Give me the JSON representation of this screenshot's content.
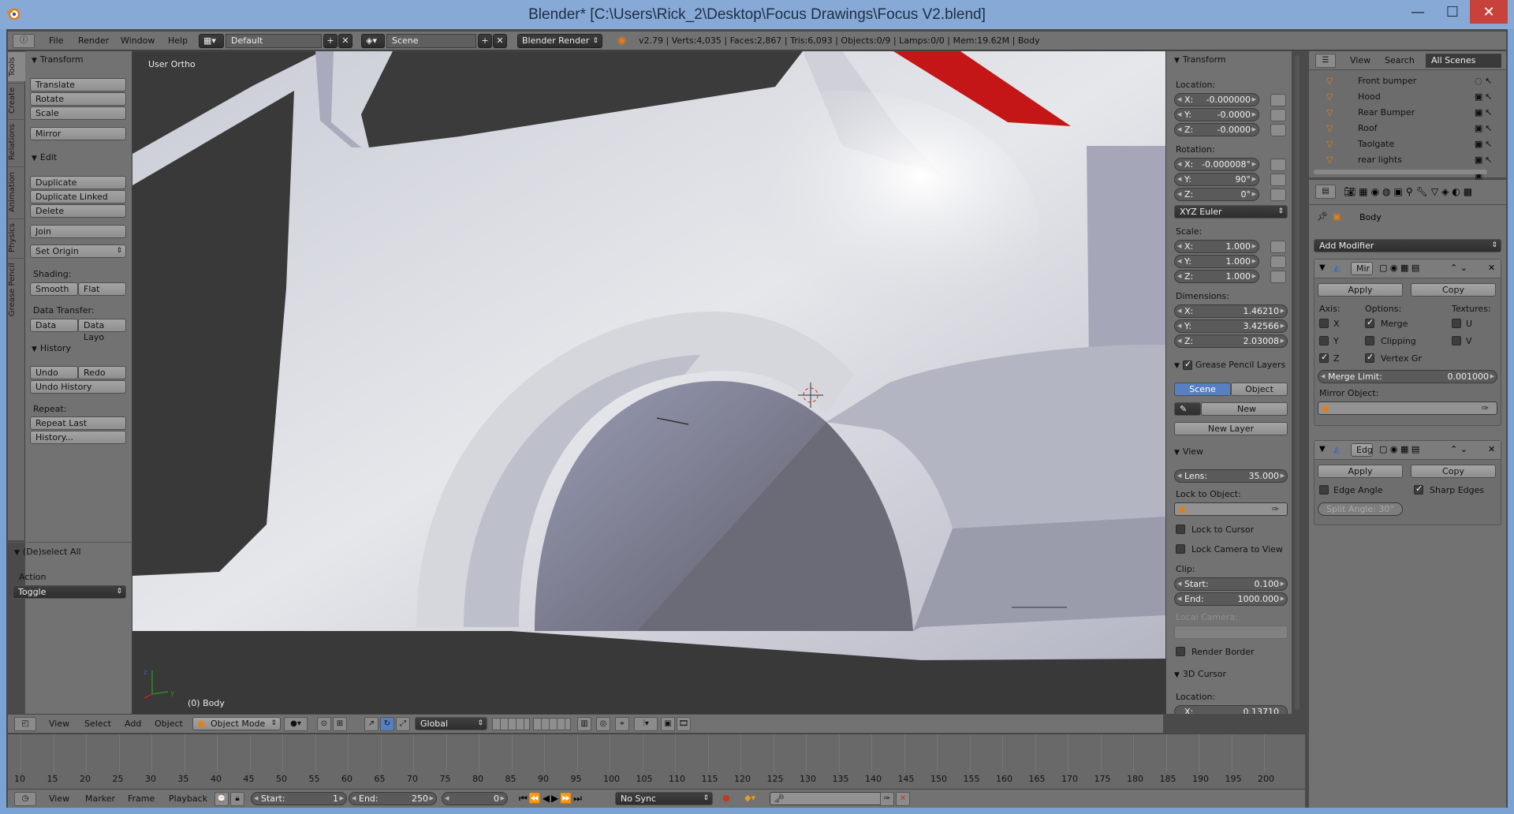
{
  "window": {
    "title": "Blender* [C:\\Users\\Rick_2\\Desktop\\Focus Drawings\\Focus V2.blend]",
    "minimize_glyph": "—",
    "maximize_glyph": "☐",
    "close_glyph": "✕"
  },
  "topbar": {
    "menus": [
      "File",
      "Render",
      "Window",
      "Help"
    ],
    "layout": "Default",
    "scene": "Scene",
    "engine": "Blender Render",
    "stats": "v2.79 | Verts:4,035 | Faces:2,867 | Tris:6,093 | Objects:0/9 | Lamps:0/0 | Mem:19.62M | Body"
  },
  "tabs": [
    "Tools",
    "Create",
    "Relations",
    "Animation",
    "Physics",
    "Grease Pencil"
  ],
  "toolshelf": {
    "transform": {
      "title": "Transform",
      "buttons": [
        "Translate",
        "Rotate",
        "Scale",
        "Mirror"
      ]
    },
    "edit": {
      "title": "Edit",
      "buttons": [
        "Duplicate",
        "Duplicate Linked",
        "Delete",
        "Join",
        "Set Origin"
      ]
    },
    "shading": {
      "label": "Shading:",
      "smooth": "Smooth",
      "flat": "Flat"
    },
    "data_transfer": {
      "label": "Data Transfer:",
      "data": "Data",
      "data_layo": "Data Layo"
    },
    "history": {
      "title": "History",
      "undo": "Undo",
      "redo": "Redo",
      "undo_history": "Undo History",
      "repeat_label": "Repeat:",
      "repeat_last": "Repeat Last",
      "history_more": "History..."
    },
    "operator": {
      "title": "(De)select All",
      "action_label": "Action",
      "action_value": "Toggle"
    }
  },
  "viewport": {
    "label": "User Ortho",
    "object_label": "(0) Body"
  },
  "npanel": {
    "transform_title": "Transform",
    "location_label": "Location:",
    "location": {
      "x": "-0.000000",
      "y": "-0.0000",
      "z": "-0.0000"
    },
    "rotation_label": "Rotation:",
    "rotation": {
      "x": "-0.000008°",
      "y": "90°",
      "z": "0°"
    },
    "rotation_mode": "XYZ Euler",
    "scale_label": "Scale:",
    "scale": {
      "x": "1.000",
      "y": "1.000",
      "z": "1.000"
    },
    "dimensions_label": "Dimensions:",
    "dimensions": {
      "x": "1.46210",
      "y": "3.42566",
      "z": "2.03008"
    },
    "grease_title": "Grease Pencil Layers",
    "grease_scene": "Scene",
    "grease_object": "Object",
    "grease_new": "New",
    "grease_new_layer": "New Layer",
    "view_title": "View",
    "lens_label": "Lens:",
    "lens_value": "35.000",
    "lock_to_object": "Lock to Object:",
    "lock_to_cursor": "Lock to Cursor",
    "lock_camera": "Lock Camera to View",
    "clip_label": "Clip:",
    "clip_start_label": "Start:",
    "clip_start": "0.100",
    "clip_end_label": "End:",
    "clip_end": "1000.000",
    "local_camera": "Local Camera:",
    "render_border": "Render Border",
    "cursor_title": "3D Cursor",
    "cursor_location": "Location:",
    "cursor_x_label": "X:",
    "cursor_x": "0.13710"
  },
  "outliner": {
    "menus": [
      "View",
      "Search"
    ],
    "filter": "All Scenes",
    "items": [
      "Front bumper",
      "Hood",
      "Rear Bumper",
      "Roof",
      "Taolgate",
      "rear lights"
    ]
  },
  "properties": {
    "object": "Body",
    "add_modifier": "Add Modifier",
    "mirror": {
      "name": "Mir",
      "apply": "Apply",
      "copy": "Copy",
      "axis_label": "Axis:",
      "options_label": "Options:",
      "textures_label": "Textures:",
      "x": "X",
      "y": "Y",
      "z": "Z",
      "merge": "Merge",
      "clipping": "Clipping",
      "vertex_gr": "Vertex Gr",
      "u": "U",
      "v": "V",
      "merge_limit_label": "Merge Limit:",
      "merge_limit": "0.001000",
      "mirror_object": "Mirror Object:"
    },
    "edge_split": {
      "name": "Edg",
      "apply": "Apply",
      "copy": "Copy",
      "edge_angle": "Edge Angle",
      "sharp_edges": "Sharp Edges",
      "split_angle": "Split Angle: 30°"
    }
  },
  "viewport_header": {
    "menus": [
      "View",
      "Select",
      "Add",
      "Object"
    ],
    "mode": "Object Mode",
    "orientation": "Global"
  },
  "timeline": {
    "ticks": [
      "10",
      "15",
      "20",
      "25",
      "30",
      "35",
      "40",
      "45",
      "50",
      "55",
      "60",
      "65",
      "70",
      "75",
      "80",
      "85",
      "90",
      "95",
      "100",
      "105",
      "110",
      "115",
      "120",
      "125",
      "130",
      "135",
      "140",
      "145",
      "150",
      "155",
      "160",
      "165",
      "170",
      "175",
      "180",
      "185",
      "190",
      "195",
      "200"
    ],
    "menus": [
      "View",
      "Marker",
      "Frame",
      "Playback"
    ],
    "start_label": "Start:",
    "start": "1",
    "end_label": "End:",
    "end": "250",
    "current": "0",
    "sync": "No Sync"
  }
}
